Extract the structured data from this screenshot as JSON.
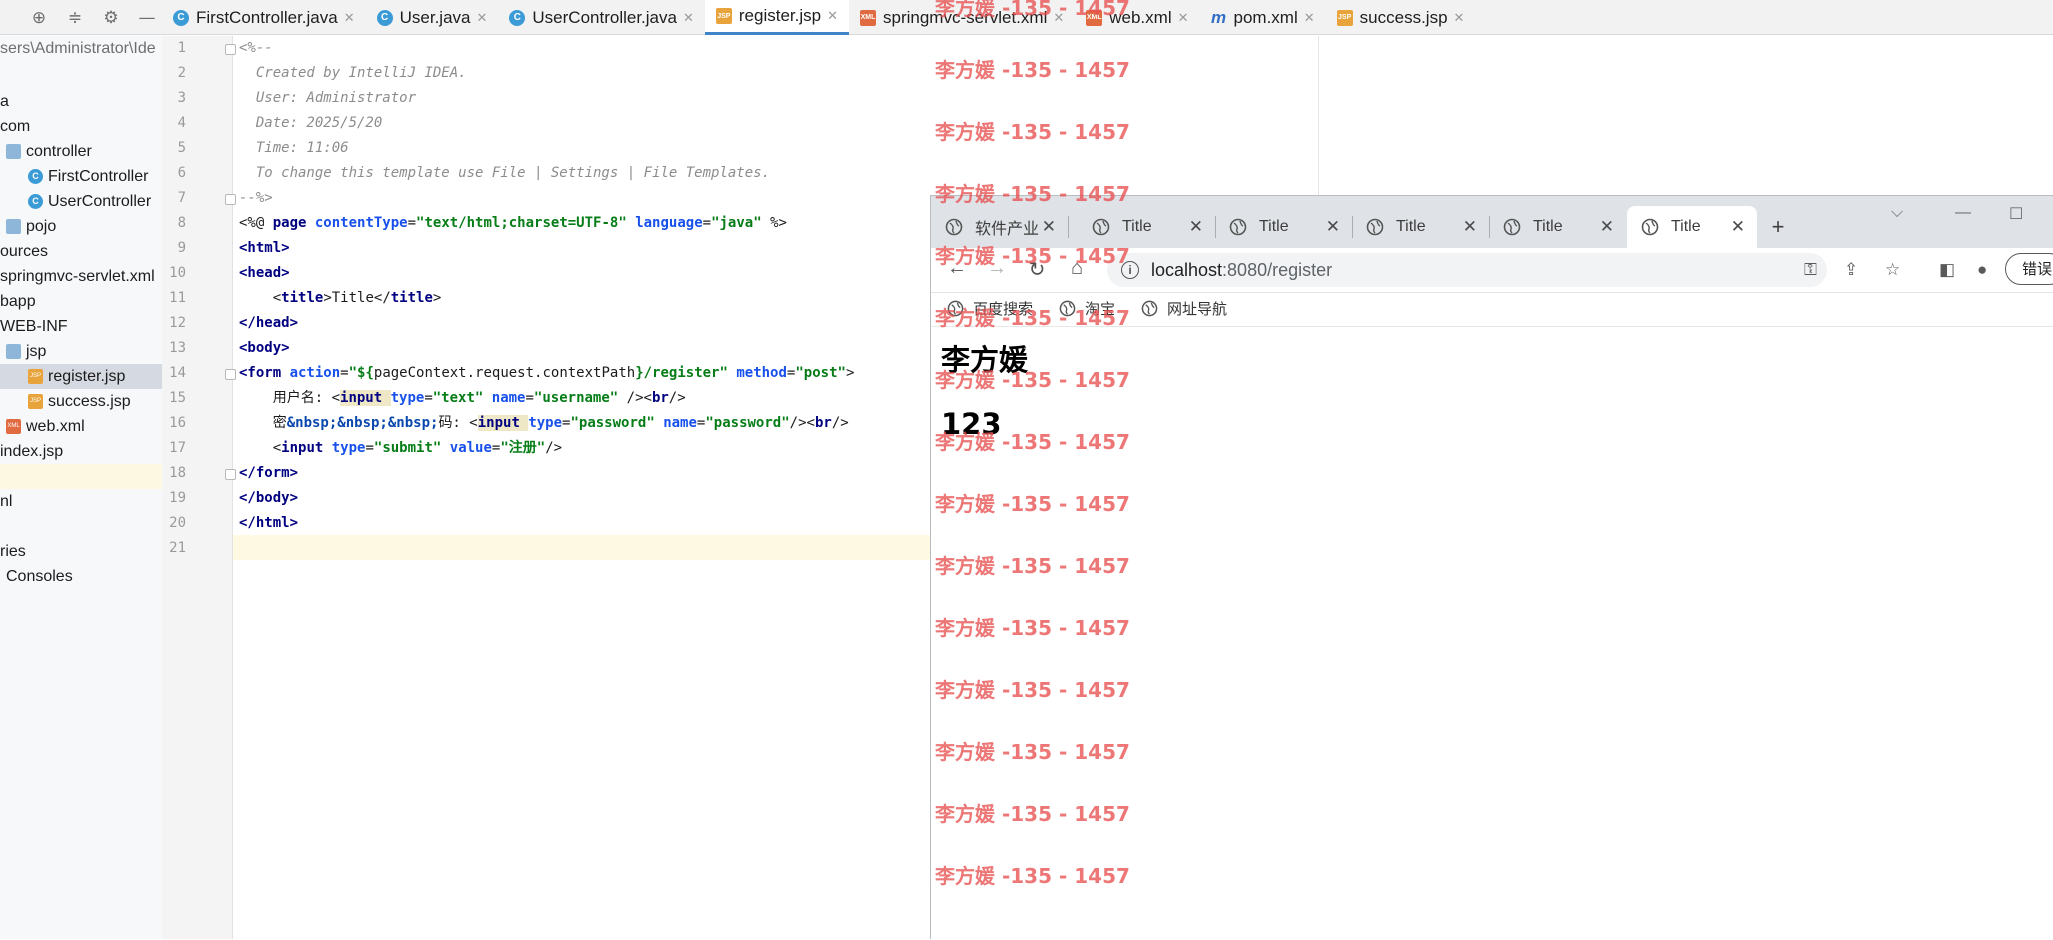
{
  "editor_tabs": [
    {
      "label": "FirstController.java",
      "kind": "java",
      "active": false
    },
    {
      "label": "User.java",
      "kind": "java",
      "active": false
    },
    {
      "label": "UserController.java",
      "kind": "java",
      "active": false
    },
    {
      "label": "register.jsp",
      "kind": "jsp",
      "active": true
    },
    {
      "label": "springmvc-servlet.xml",
      "kind": "xml",
      "active": false
    },
    {
      "label": "web.xml",
      "kind": "xml",
      "active": false
    },
    {
      "label": "pom.xml",
      "kind": "maven",
      "active": false
    },
    {
      "label": "success.jsp",
      "kind": "jsp",
      "active": false
    }
  ],
  "project_tree": {
    "path": "sers\\Administrator\\Ide",
    "items": [
      {
        "label": "a",
        "icon": "none"
      },
      {
        "label": "com",
        "icon": "none"
      },
      {
        "label": "controller",
        "icon": "folder-icon"
      },
      {
        "label": "FirstController",
        "icon": "class-icon"
      },
      {
        "label": "UserController",
        "icon": "class-icon"
      },
      {
        "label": "pojo",
        "icon": "folder-icon"
      },
      {
        "label": "ources",
        "icon": "none"
      },
      {
        "label": "springmvc-servlet.xml",
        "icon": "none"
      },
      {
        "label": "bapp",
        "icon": "none"
      },
      {
        "label": "WEB-INF",
        "icon": "none"
      },
      {
        "label": "jsp",
        "icon": "folder-icon"
      },
      {
        "label": "register.jsp",
        "icon": "jsp-file-icon"
      },
      {
        "label": "success.jsp",
        "icon": "jsp-file-icon"
      },
      {
        "label": "web.xml",
        "icon": "xml-file-icon"
      },
      {
        "label": "index.jsp",
        "icon": "none"
      },
      {
        "label": "",
        "icon": "none"
      },
      {
        "label": "nl",
        "icon": "none"
      },
      {
        "label": "",
        "icon": "none"
      },
      {
        "label": "ries",
        "icon": "none"
      },
      {
        "label": "Consoles",
        "icon": "none"
      }
    ]
  },
  "editor": {
    "line_numbers": [
      "1",
      "2",
      "3",
      "4",
      "5",
      "6",
      "7",
      "8",
      "9",
      "10",
      "11",
      "12",
      "13",
      "14",
      "15",
      "16",
      "17",
      "18",
      "19",
      "20",
      "21"
    ],
    "lines": [
      {
        "t": [
          [
            "cm",
            "<%--"
          ]
        ]
      },
      {
        "t": [
          [
            "cm",
            "  Created by IntelliJ IDEA."
          ]
        ]
      },
      {
        "t": [
          [
            "cm",
            "  User: Administrator"
          ]
        ]
      },
      {
        "t": [
          [
            "cm",
            "  Date: 2025/5/20"
          ]
        ]
      },
      {
        "t": [
          [
            "cm",
            "  Time: 11:06"
          ]
        ]
      },
      {
        "t": [
          [
            "cm",
            "  To change this template use File | Settings | File Templates."
          ]
        ]
      },
      {
        "t": [
          [
            "cm",
            "--%>"
          ]
        ]
      },
      {
        "t": [
          [
            "",
            "<%@ "
          ],
          [
            "kw",
            "page "
          ],
          [
            "at",
            "contentType"
          ],
          [
            "",
            "="
          ],
          [
            "st",
            "\"text/html;charset=UTF-8\""
          ],
          [
            "",
            " "
          ],
          [
            "at",
            "language"
          ],
          [
            "",
            "="
          ],
          [
            "st",
            "\"java\""
          ],
          [
            "",
            " %>"
          ]
        ]
      },
      {
        "t": [
          [
            "kw",
            "<html>"
          ]
        ]
      },
      {
        "t": [
          [
            "kw",
            "<head>"
          ]
        ]
      },
      {
        "t": [
          [
            "",
            "    <"
          ],
          [
            "kw",
            "title"
          ],
          [
            "",
            ">Title</"
          ],
          [
            "kw",
            "title"
          ],
          [
            "",
            ">"
          ]
        ]
      },
      {
        "t": [
          [
            "kw",
            "</head>"
          ]
        ]
      },
      {
        "t": [
          [
            "kw",
            "<body>"
          ]
        ]
      },
      {
        "t": [
          [
            "kw",
            "<form "
          ],
          [
            "at",
            "action"
          ],
          [
            "",
            "="
          ],
          [
            "st",
            "\"${"
          ],
          [
            "",
            "pageContext.request.contextPath"
          ],
          [
            "st",
            "}/register\""
          ],
          [
            "",
            " "
          ],
          [
            "at",
            "method"
          ],
          [
            "",
            "="
          ],
          [
            "st",
            "\"post\""
          ],
          [
            "",
            ">"
          ]
        ]
      },
      {
        "t": [
          [
            "",
            "    用户名: <"
          ],
          [
            "kw hl",
            "input "
          ],
          [
            "at",
            "type"
          ],
          [
            "",
            "="
          ],
          [
            "st",
            "\"text\""
          ],
          [
            "",
            " "
          ],
          [
            "at",
            "name"
          ],
          [
            "",
            "="
          ],
          [
            "st",
            "\"username\""
          ],
          [
            "",
            " /><"
          ],
          [
            "kw",
            "br"
          ],
          [
            "",
            "/>"
          ]
        ]
      },
      {
        "t": [
          [
            "",
            "    密"
          ],
          [
            "ent",
            "&nbsp;&nbsp;&nbsp;"
          ],
          [
            "",
            "码: <"
          ],
          [
            "kw hl",
            "input "
          ],
          [
            "at",
            "type"
          ],
          [
            "",
            "="
          ],
          [
            "st",
            "\"password\""
          ],
          [
            "",
            " "
          ],
          [
            "at",
            "name"
          ],
          [
            "",
            "="
          ],
          [
            "st",
            "\"password\""
          ],
          [
            "",
            "/><"
          ],
          [
            "kw",
            "br"
          ],
          [
            "",
            "/>"
          ]
        ]
      },
      {
        "t": [
          [
            "",
            "    <"
          ],
          [
            "kw",
            "input "
          ],
          [
            "at",
            "type"
          ],
          [
            "",
            "="
          ],
          [
            "st",
            "\"submit\""
          ],
          [
            "",
            " "
          ],
          [
            "at",
            "value"
          ],
          [
            "",
            "="
          ],
          [
            "st",
            "\"注册\""
          ],
          [
            "",
            "/>"
          ]
        ]
      },
      {
        "t": [
          [
            "kw",
            "</form>"
          ]
        ]
      },
      {
        "t": [
          [
            "kw",
            "</body>"
          ]
        ]
      },
      {
        "t": [
          [
            "kw",
            "</html>"
          ]
        ]
      },
      {
        "t": [
          [
            "",
            ""
          ]
        ]
      }
    ]
  },
  "browser": {
    "tabs": [
      {
        "label": "软件产业",
        "active": false
      },
      {
        "label": "Title",
        "active": false
      },
      {
        "label": "Title",
        "active": false
      },
      {
        "label": "Title",
        "active": false
      },
      {
        "label": "Title",
        "active": false
      },
      {
        "label": "Title",
        "active": true
      }
    ],
    "new_tab": "+",
    "url_host": "localhost",
    "url_path": ":8080/register",
    "error_button": "错误",
    "bookmarks": [
      "百度搜索",
      "淘宝",
      "网址导航"
    ],
    "page": {
      "line1": "李方媛",
      "line2": "123"
    }
  },
  "watermark": "李方媛 -135 - 1457",
  "colors": {
    "accent": "#4083c9",
    "watermark": "#e85050"
  }
}
